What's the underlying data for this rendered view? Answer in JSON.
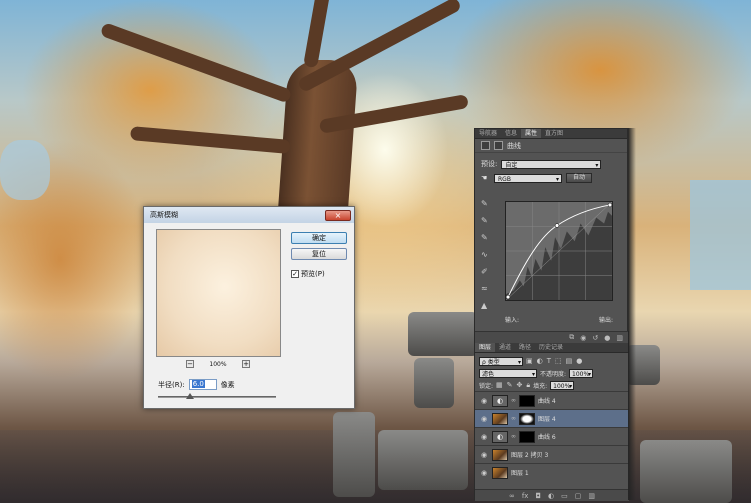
{
  "dialog": {
    "title": "高斯模糊",
    "close_icon": "×",
    "ok_label": "确定",
    "reset_label": "复位",
    "preview_check": "✓",
    "preview_label": "预览(P)",
    "zoom_out": "−",
    "zoom_in": "+",
    "zoom_level": "100%",
    "radius_label": "半径(R):",
    "radius_value": "6.0",
    "radius_unit": "像素"
  },
  "panels": {
    "top_tabs": [
      "导航器",
      "信息",
      "属性",
      "直方图"
    ],
    "properties_title": "曲线",
    "preset_label": "预设:",
    "preset_value": "自定",
    "channel_value": "RGB",
    "auto_label": "自动",
    "input_label": "输入:",
    "output_label": "输出:"
  },
  "layers": {
    "tabs": [
      "图层",
      "通道",
      "路径",
      "历史记录"
    ],
    "filter_kind": "ρ 类型",
    "blend_mode": "滤色",
    "opacity_label": "不透明度:",
    "opacity_value": "100%",
    "lock_label": "锁定:",
    "fill_label": "填充:",
    "fill_value": "100%",
    "items": [
      {
        "name": "曲线 4",
        "selected": false
      },
      {
        "name": "图层 4",
        "selected": true
      },
      {
        "name": "曲线 6",
        "selected": false
      },
      {
        "name": "图层 2 拷贝 3",
        "selected": false
      },
      {
        "name": "图层 1",
        "selected": false
      }
    ]
  },
  "colors": {
    "panel_bg": "#535353",
    "selected_layer": "#5d6f8a",
    "dialog_bg": "#f0f0f0"
  }
}
